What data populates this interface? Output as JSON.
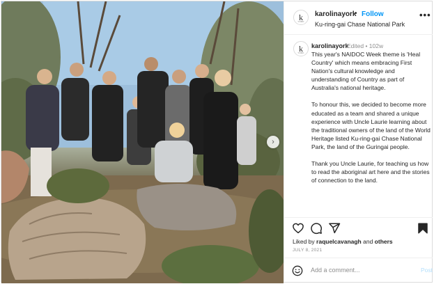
{
  "post": {
    "username": "karolinayork",
    "follow_label": "Follow",
    "location": "Ku-ring-gai Chase National Park",
    "header_separator": "•",
    "more_icon": "more-horizontal-icon",
    "avatar_letter": "k",
    "avatar_wordmark": "YORK"
  },
  "caption": {
    "username": "karolinayork",
    "meta": "Edited  •  102w",
    "paragraphs": [
      "This year's NAIDOC Week theme is 'Heal Country' which means embracing First Nation's cultural knowledge and understanding of Country as part of Australia's national heritage.",
      "To honour this, we decided to become more educated as a team and shared a unique experience with Uncle Laurie learning about the traditional owners of the land of the World Heritage listed Ku-ring-gai Chase National Park, the land of the Guringai people.",
      "Thank you Uncle Laurie, for teaching us how to read the aboriginal art here and the stories of connection to the land."
    ]
  },
  "actions": {
    "like_icon": "heart-icon",
    "comment_icon": "comment-icon",
    "share_icon": "send-icon",
    "save_icon": "bookmark-icon",
    "likes_prefix": "Liked by ",
    "liked_by_user": "raquelcavanagh",
    "likes_and": " and ",
    "likes_others": "others",
    "date": "JULY 8, 2021"
  },
  "comment": {
    "placeholder": "Add a comment...",
    "post_label": "Post",
    "emoji_icon": "emoji-icon"
  },
  "media": {
    "next_label": "›",
    "next_icon": "chevron-right-icon"
  },
  "colors": {
    "link_blue": "#0095f6",
    "post_disabled": "#b2dffc",
    "secondary_text": "#8e8e8e"
  }
}
